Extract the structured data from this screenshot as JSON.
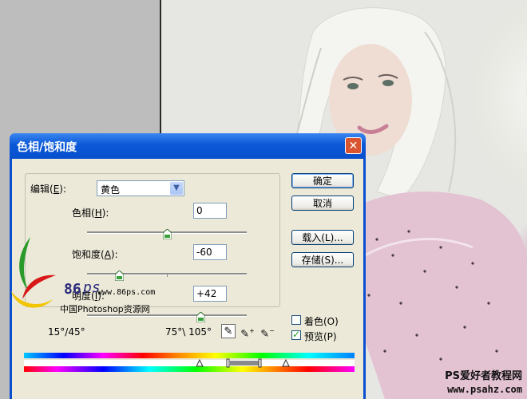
{
  "dialog": {
    "title": "色相/饱和度",
    "edit_label": "编辑(",
    "edit_key": "E",
    "edit_suffix": "):",
    "edit_value": "黄色",
    "hue": {
      "label": "色相(",
      "key": "H",
      "suffix": "):",
      "value": "0",
      "level": 0.5
    },
    "saturation": {
      "label": "饱和度(",
      "key": "A",
      "suffix": "):",
      "value": "-60",
      "level": 0.2
    },
    "lightness": {
      "label": "明度(",
      "key": "I",
      "suffix": "):",
      "value": "+42",
      "level": 0.71
    },
    "buttons": {
      "ok": "确定",
      "cancel": "取消",
      "load": "载入(L)...",
      "save": "存储(S)..."
    },
    "colorize": {
      "label": "着色(O)",
      "checked": false
    },
    "preview": {
      "label": "预览(P)",
      "checked": true
    },
    "angle_left": "15°/45°",
    "angle_right": "75°\\ 105°"
  },
  "watermark": {
    "logo_number": "86",
    "logo_letters": "ps",
    "logo_url": "www.86ps.com",
    "logo_caption": "中国Photoshop资源网",
    "site_name": "PS爱好者教程网",
    "site_url": "www.psahz.com"
  },
  "colors": {
    "title_bar": "#0a58d8",
    "dialog_face": "#ece9d8",
    "close_button": "#d9542f"
  }
}
